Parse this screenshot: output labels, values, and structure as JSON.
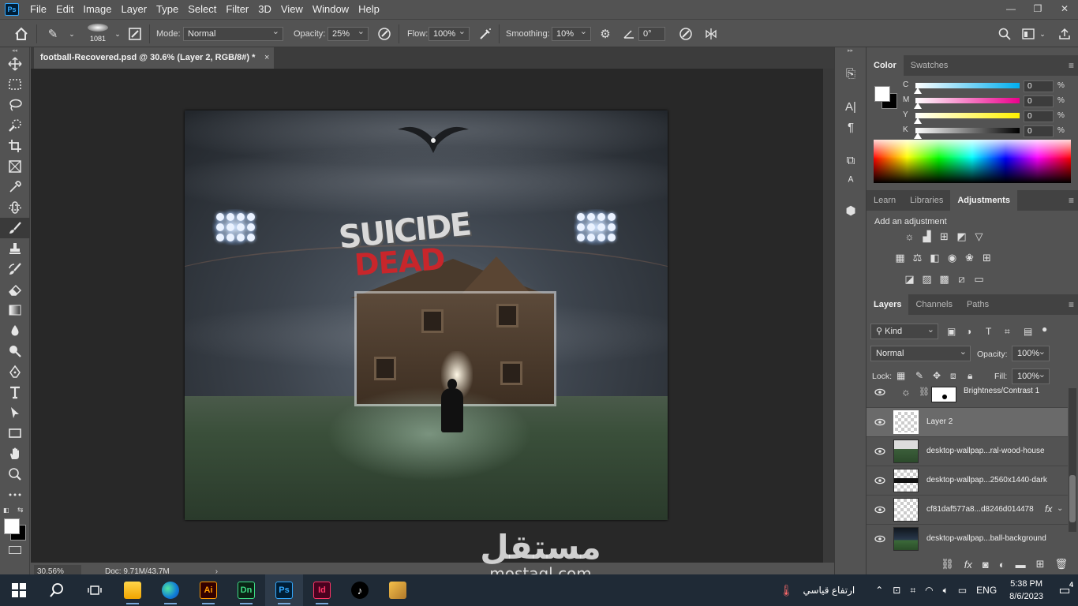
{
  "menubar": {
    "logo": "Ps",
    "items": [
      "File",
      "Edit",
      "Image",
      "Layer",
      "Type",
      "Select",
      "Filter",
      "3D",
      "View",
      "Window",
      "Help"
    ]
  },
  "options": {
    "brush_size": "1081",
    "mode_label": "Mode:",
    "mode_value": "Normal",
    "opacity_label": "Opacity:",
    "opacity_value": "25%",
    "flow_label": "Flow:",
    "flow_value": "100%",
    "smoothing_label": "Smoothing:",
    "smoothing_value": "10%",
    "angle_value": "0°"
  },
  "document": {
    "tab_title": "football-Recovered.psd @ 30.6% (Layer 2, RGB/8#) *",
    "zoom": "30.56%",
    "doc_info": "Doc: 9.71M/43.7M",
    "artwork_title_1": "SUICIDE",
    "artwork_title_2": "DEAD"
  },
  "color_panel": {
    "tabs": [
      "Color",
      "Swatches"
    ],
    "channels": [
      {
        "letter": "C",
        "value": "0",
        "unit": "%",
        "color": "#00aeef"
      },
      {
        "letter": "M",
        "value": "0",
        "unit": "%",
        "color": "#ec008c"
      },
      {
        "letter": "Y",
        "value": "0",
        "unit": "%",
        "color": "#fff200"
      },
      {
        "letter": "K",
        "value": "0",
        "unit": "%",
        "color": "#000000"
      }
    ]
  },
  "adjust_panel": {
    "tabs": [
      "Learn",
      "Libraries",
      "Adjustments"
    ],
    "title": "Add an adjustment"
  },
  "layers_panel": {
    "tabs": [
      "Layers",
      "Channels",
      "Paths"
    ],
    "filter_kind": "Kind",
    "blend_mode": "Normal",
    "opacity_label": "Opacity:",
    "opacity_value": "100%",
    "lock_label": "Lock:",
    "fill_label": "Fill:",
    "fill_value": "100%",
    "layers": [
      {
        "name": "Brightness/Contrast 1",
        "type": "adjustment",
        "selected": false
      },
      {
        "name": "Layer 2",
        "type": "empty",
        "selected": true
      },
      {
        "name": "desktop-wallpap...ral-wood-house",
        "type": "image",
        "selected": false
      },
      {
        "name": "desktop-wallpap...2560x1440-dark",
        "type": "image",
        "selected": false
      },
      {
        "name": "cf81daf577a8...d8246d014478",
        "type": "empty",
        "fx": "fx",
        "selected": false
      },
      {
        "name": "desktop-wallpap...ball-background",
        "type": "image",
        "selected": false
      }
    ]
  },
  "taskbar": {
    "weather": "ارتفاع قياسي",
    "language": "ENG",
    "time": "5:38 PM",
    "date": "8/6/2023",
    "notifications": "4",
    "apps": [
      {
        "name": "Ai",
        "color": "#ff9a00",
        "bg": "#330000"
      },
      {
        "name": "Dn",
        "color": "#3ddc84",
        "bg": "#0a2414"
      },
      {
        "name": "Ps",
        "color": "#31a8ff",
        "bg": "#001e36"
      },
      {
        "name": "Id",
        "color": "#ff3366",
        "bg": "#49021f"
      }
    ]
  },
  "watermark": {
    "arabic": "مستقل",
    "latin": "mostaql.com"
  }
}
